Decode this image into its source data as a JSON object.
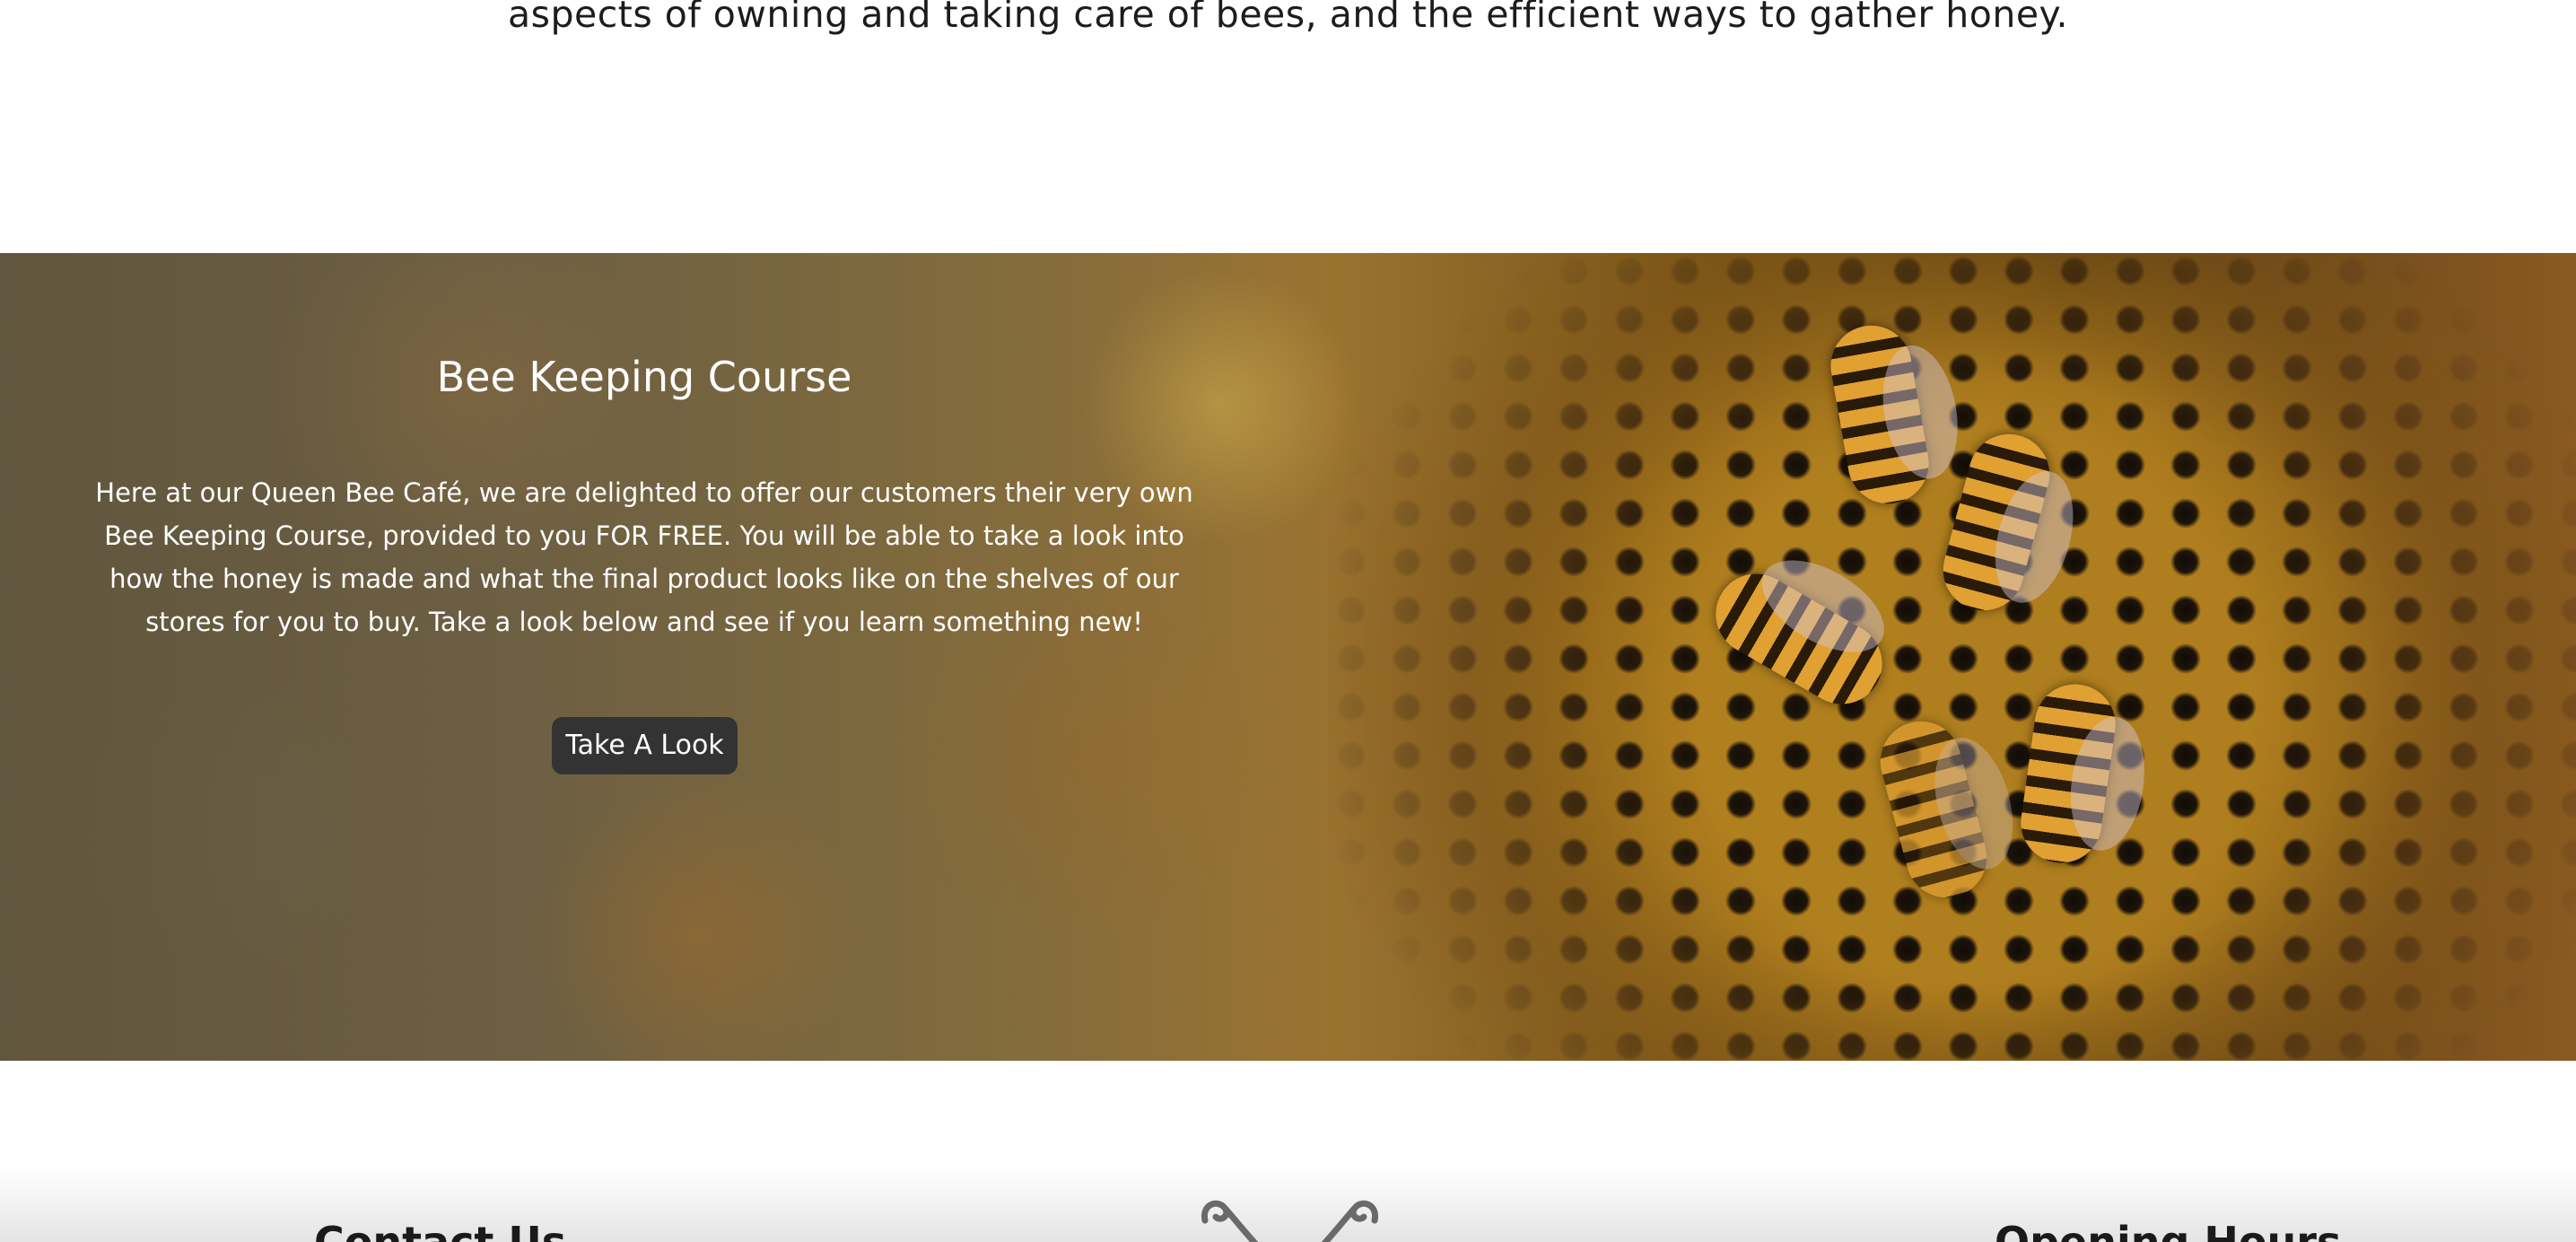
{
  "intro": {
    "text": "aspects of owning and taking care of bees, and the efficient ways to gather honey."
  },
  "course": {
    "title": "Bee Keeping Course",
    "body": "Here at our Queen Bee Café, we are delighted to offer our customers their very own Bee Keeping Course, provided to you FOR FREE. You will be able to take a look into how the honey is made and what the final product looks like on the shelves of our stores for you to buy. Take a look below and see if you learn something new!",
    "button_label": "Take A Look",
    "background_image": "honeycomb-with-bees"
  },
  "footer": {
    "contact_heading": "Contact Us",
    "hours_heading": "Opening Hours",
    "logo_icon": "bee-antenna-logo"
  },
  "colors": {
    "button_bg": "#333333",
    "text_dark": "#1a1a1a",
    "text_light": "#ffffff"
  }
}
